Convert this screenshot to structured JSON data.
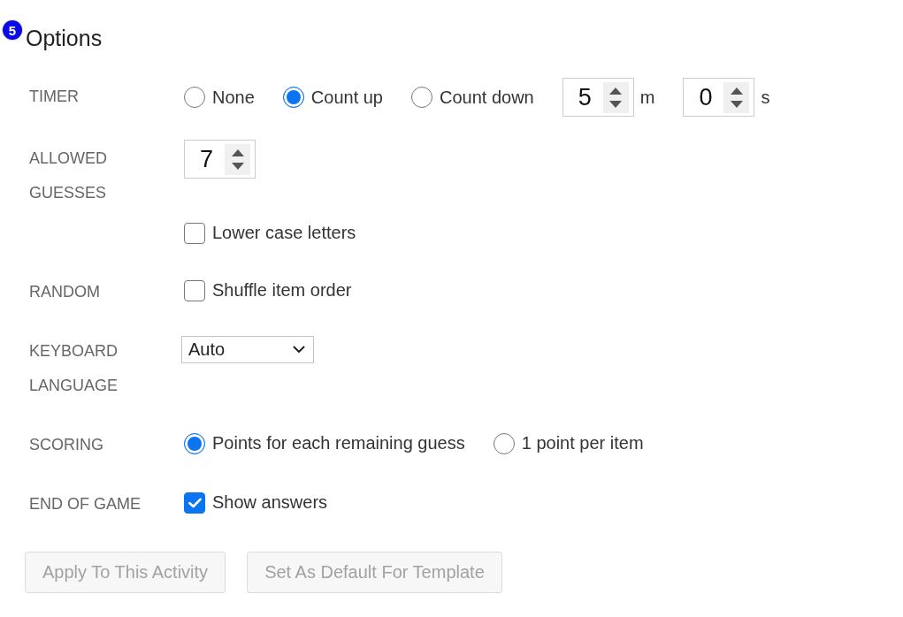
{
  "header": {
    "badge": "5",
    "title": "Options"
  },
  "rows": [
    {
      "label": "TIMER",
      "controls": [
        {
          "kind": "radio",
          "label": "None",
          "selected": false
        },
        {
          "kind": "radio",
          "label": "Count up",
          "selected": true
        },
        {
          "kind": "radio",
          "label": "Count down",
          "selected": false
        },
        {
          "kind": "spinner",
          "value": "5",
          "unit": "m"
        },
        {
          "kind": "spinner",
          "value": "0",
          "unit": "s"
        }
      ]
    },
    {
      "label": "ALLOWED GUESSES",
      "controls": [
        {
          "kind": "spinner",
          "value": "7"
        }
      ]
    },
    {
      "controls": [
        {
          "kind": "checkbox",
          "label": "Lower case letters",
          "checked": false
        }
      ]
    },
    {
      "label": "RANDOM",
      "controls": [
        {
          "kind": "checkbox",
          "label": "Shuffle item order",
          "checked": false
        }
      ]
    },
    {
      "label": "KEYBOARD LANGUAGE",
      "controls": [
        {
          "kind": "select",
          "value": "Auto"
        }
      ]
    },
    {
      "label": "SCORING",
      "controls": [
        {
          "kind": "radio",
          "label": "Points for each remaining guess",
          "selected": true
        },
        {
          "kind": "radio",
          "label": "1 point per item",
          "selected": false
        }
      ]
    },
    {
      "label": "END OF GAME",
      "controls": [
        {
          "kind": "checkbox",
          "label": "Show answers",
          "checked": true
        }
      ]
    }
  ],
  "buttons": [
    {
      "label": "Apply To This Activity",
      "disabled": true
    },
    {
      "label": "Set As Default For Template",
      "disabled": true
    }
  ]
}
